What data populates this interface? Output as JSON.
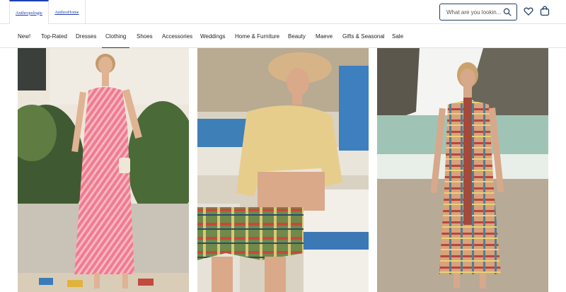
{
  "brands": [
    {
      "label": "Anthropologie",
      "active": true
    },
    {
      "label": "AnthroHome",
      "active": false
    }
  ],
  "search": {
    "placeholder": "What are you lookin..."
  },
  "icons": {
    "search": "search-icon",
    "wishlist": "heart-icon",
    "bag": "shopping-bag-icon"
  },
  "nav": {
    "items": [
      {
        "label": "New!"
      },
      {
        "label": "Top-Rated"
      },
      {
        "label": "Dresses"
      },
      {
        "label": "Clothing"
      },
      {
        "label": "Shoes"
      },
      {
        "label": "Accessories"
      },
      {
        "label": "Weddings"
      },
      {
        "label": "Home & Furniture"
      },
      {
        "label": "Beauty"
      },
      {
        "label": "Maeve"
      },
      {
        "label": "Gifts & Seasonal"
      },
      {
        "label": "Sale"
      }
    ],
    "active": "Clothing"
  },
  "colors": {
    "brand_blue": "#1f3fae",
    "search_border": "#1f3f64",
    "icon": "#1f3f64"
  }
}
